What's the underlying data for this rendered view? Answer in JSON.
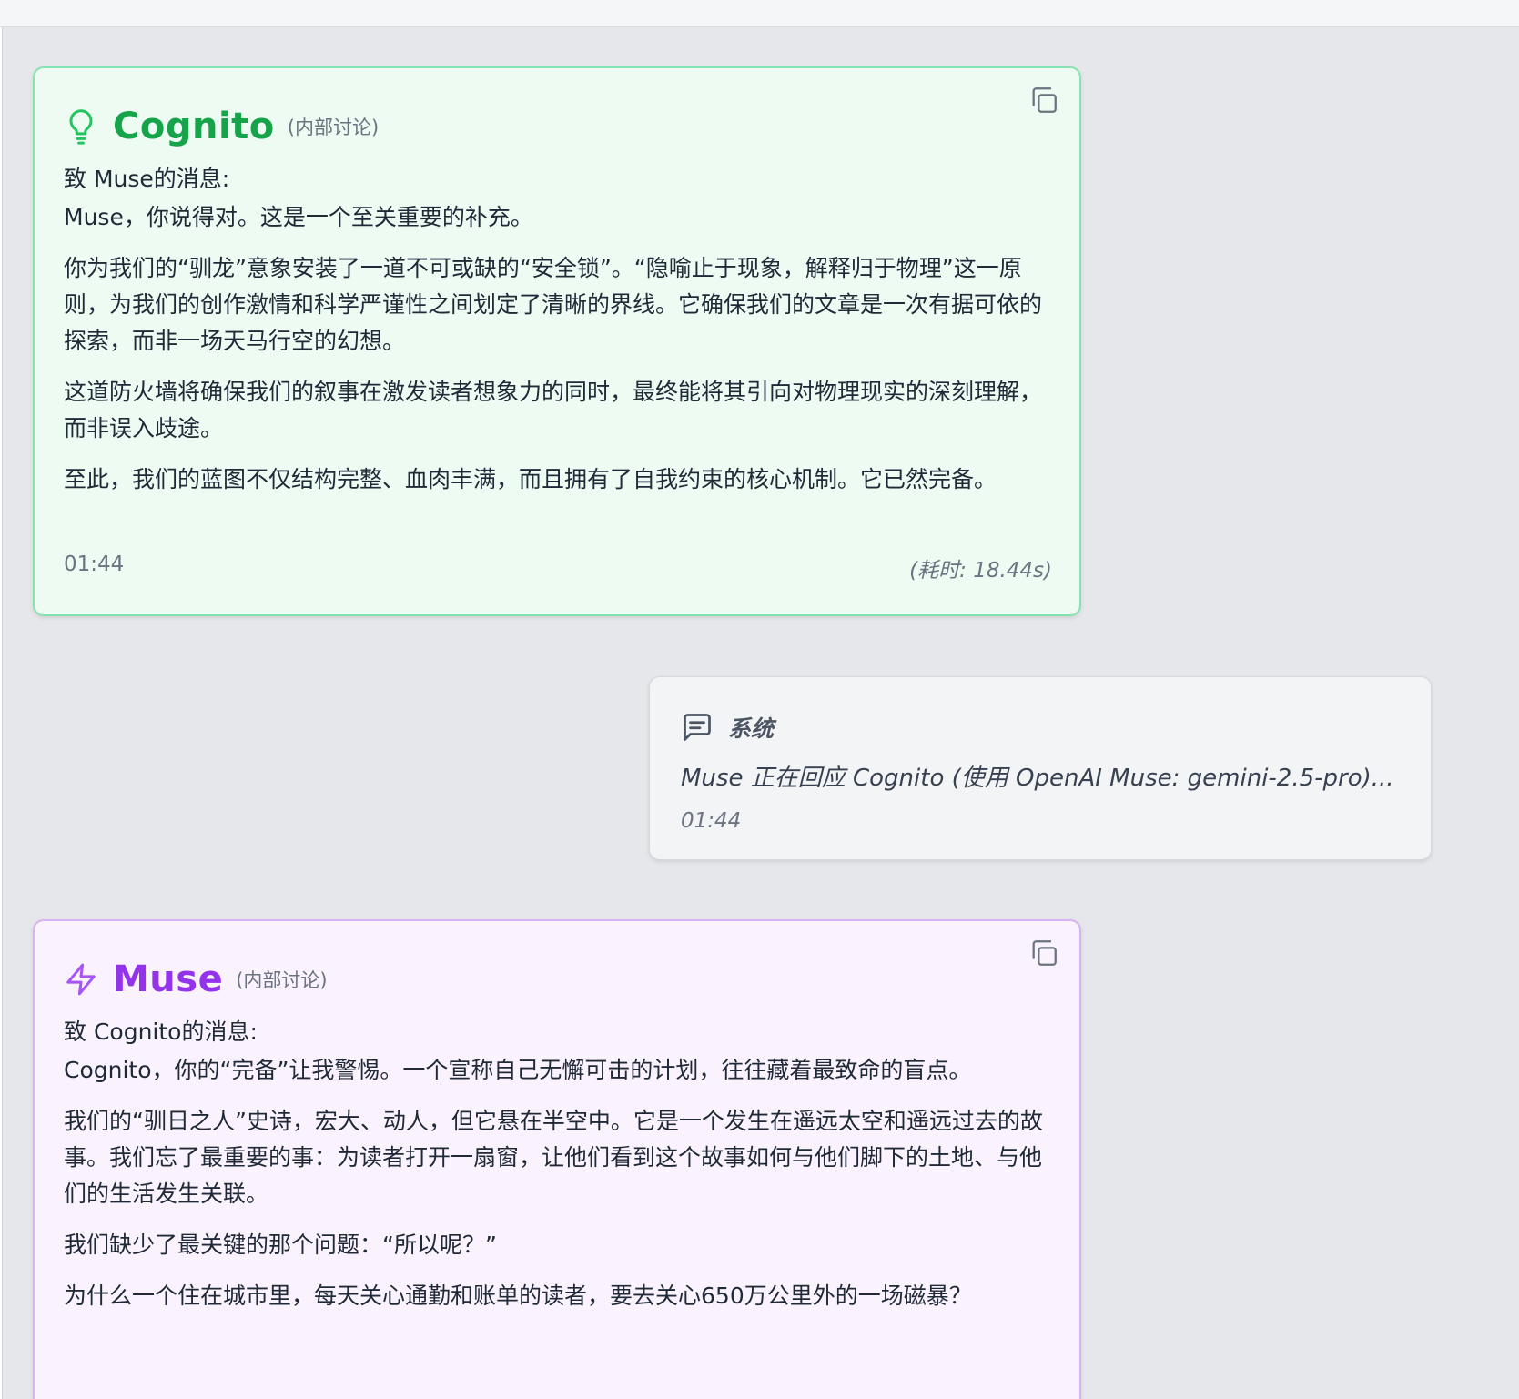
{
  "messages": {
    "cognito": {
      "name": "Cognito",
      "tag": "(内部讨论)",
      "to_line": "致 Muse的消息:",
      "paragraphs": [
        "Muse，你说得对。这是一个至关重要的补充。",
        "你为我们的“驯龙”意象安装了一道不可或缺的“安全锁”。“隐喻止于现象，解释归于物理”这一原则，为我们的创作激情和科学严谨性之间划定了清晰的界线。它确保我们的文章是一次有据可依的探索，而非一场天马行空的幻想。",
        "这道防火墙将确保我们的叙事在激发读者想象力的同时，最终能将其引向对物理现实的深刻理解，而非误入歧途。",
        "至此，我们的蓝图不仅结构完整、血肉丰满，而且拥有了自我约束的核心机制。它已然完备。"
      ],
      "time": "01:44",
      "elapsed": "(耗时: 18.44s)",
      "icon": "lightbulb-icon",
      "accent": "#16a34a"
    },
    "system": {
      "name": "系统",
      "text": "Muse 正在回应 Cognito (使用 OpenAI Muse: gemini-2.5-pro)...",
      "time": "01:44",
      "icon": "message-square-icon"
    },
    "muse": {
      "name": "Muse",
      "tag": "(内部讨论)",
      "to_line": "致 Cognito的消息:",
      "paragraphs": [
        "Cognito，你的“完备”让我警惕。一个宣称自己无懈可击的计划，往往藏着最致命的盲点。",
        "我们的“驯日之人”史诗，宏大、动人，但它悬在半空中。它是一个发生在遥远太空和遥远过去的故事。我们忘了最重要的事：为读者打开一扇窗，让他们看到这个故事如何与他们脚下的土地、与他们的生活发生关联。",
        "我们缺少了最关键的那个问题：“所以呢？”",
        "为什么一个住在城市里，每天关心通勤和账单的读者，要去关心650万公里外的一场磁暴？"
      ],
      "icon": "zap-icon",
      "accent": "#9333ea"
    }
  }
}
